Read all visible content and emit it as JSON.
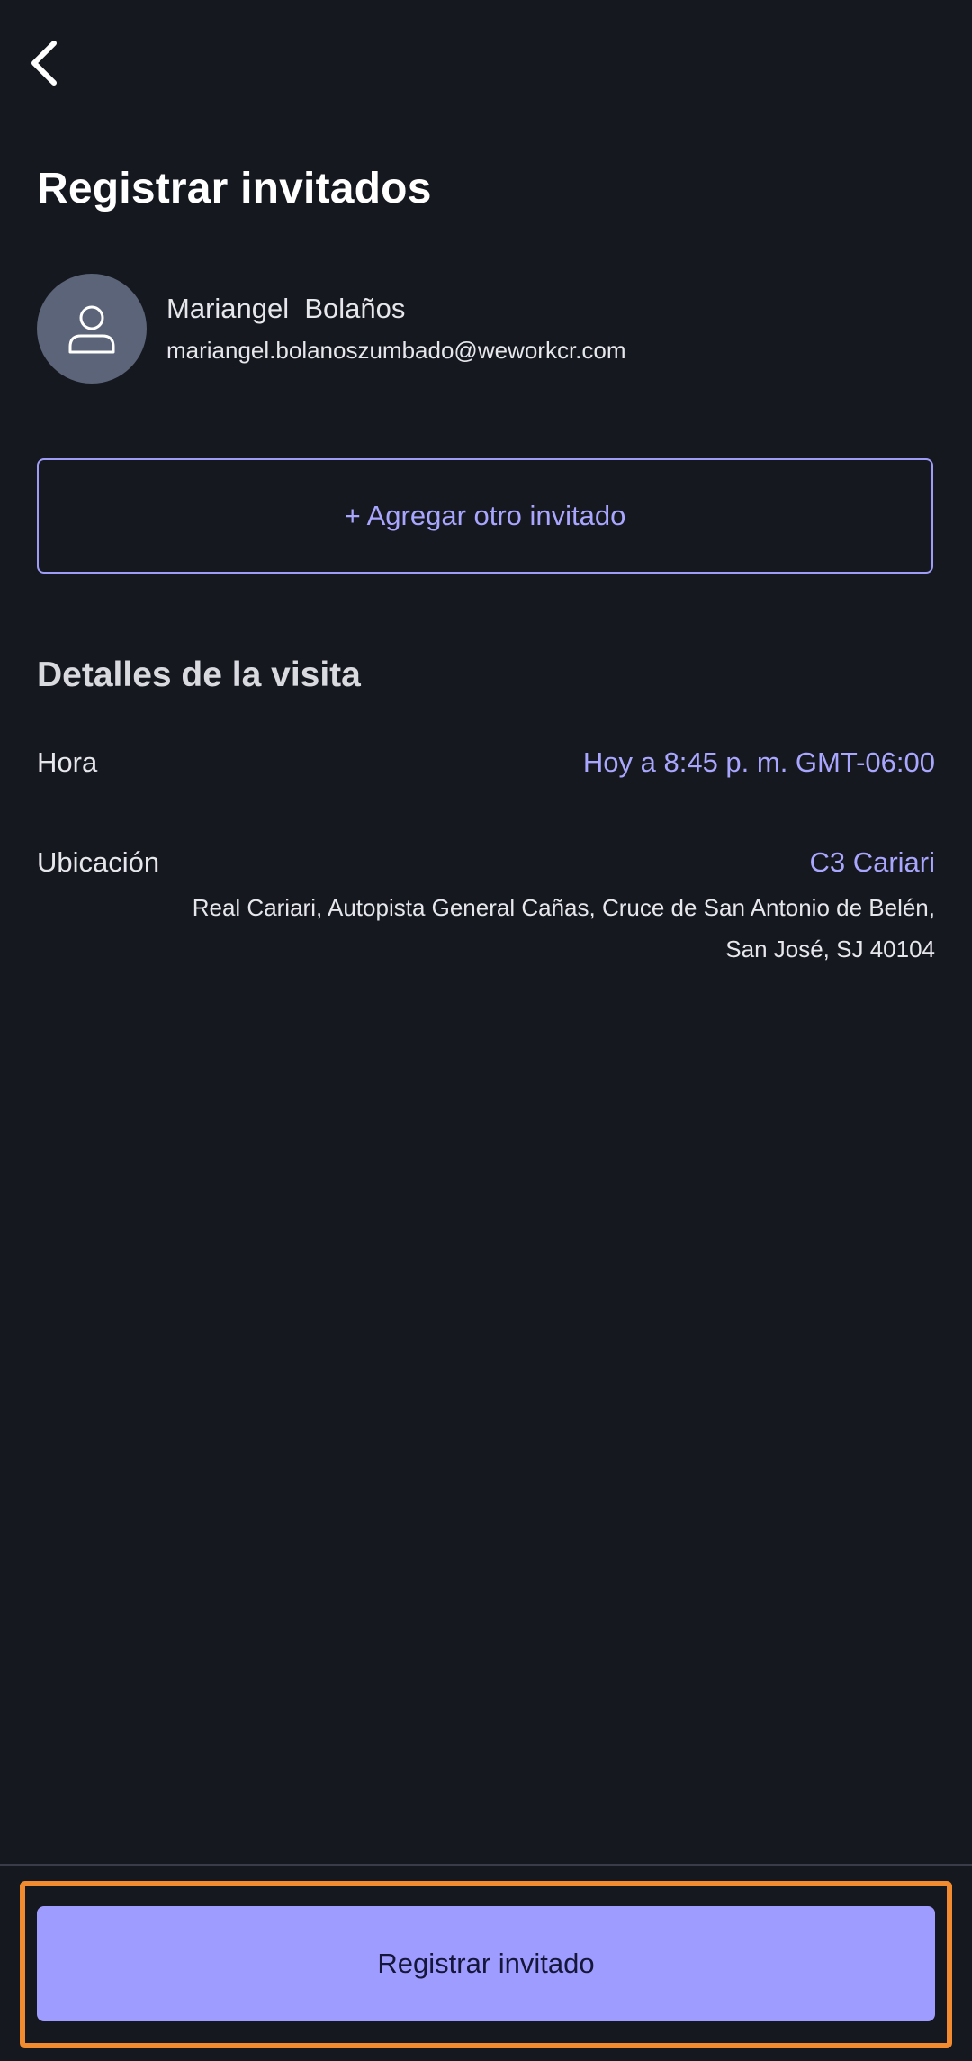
{
  "header": {
    "back_icon": "chevron-left-icon",
    "title": "Registrar invitados"
  },
  "guest": {
    "avatar_icon": "user-icon",
    "name": "Mariangel  Bolaños",
    "email": "mariangel.bolanoszumbado@weworkcr.com"
  },
  "add_guest": {
    "label": "+ Agregar otro invitado"
  },
  "details": {
    "title": "Detalles de la visita",
    "time_label": "Hora",
    "time_value": "Hoy a 8:45 p. m. GMT-06:00",
    "location_label": "Ubicación",
    "location_value": "C3 Cariari",
    "address": "Real Cariari, Autopista General Cañas, Cruce de San Antonio de Belén, San José, SJ 40104"
  },
  "footer": {
    "register_label": "Registrar invitado"
  },
  "colors": {
    "background": "#16181f",
    "accent": "#a9a6ff",
    "primary_button": "#9f9cff",
    "highlight": "#f28a30"
  }
}
